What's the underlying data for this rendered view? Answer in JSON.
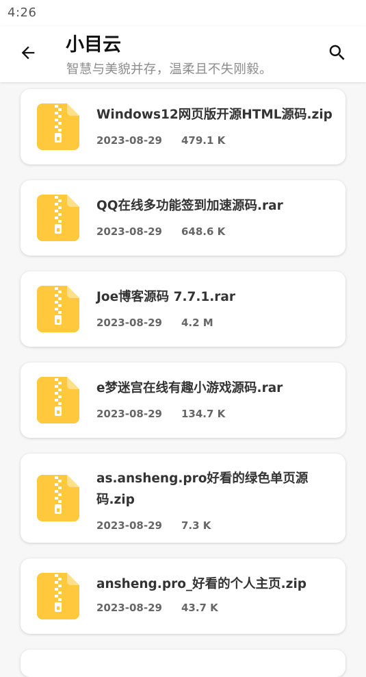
{
  "status_bar": {
    "time": "4:26"
  },
  "app_bar": {
    "title": "小目云",
    "subtitle": "智慧与美貌并存，温柔且不失刚毅。",
    "back_icon": "arrow-back-icon",
    "search_icon": "search-icon"
  },
  "colors": {
    "zip_icon": "#ffc83d",
    "zip_icon_fold": "#ffe08a",
    "text_primary": "#333333",
    "text_secondary": "#666666"
  },
  "files": [
    {
      "name": "Windows12网页版开源HTML源码.zip",
      "date": "2023-08-29",
      "size": "479.1 K",
      "icon": "zip-file-icon"
    },
    {
      "name": "QQ在线多功能签到加速源码.rar",
      "date": "2023-08-29",
      "size": "648.6 K",
      "icon": "zip-file-icon"
    },
    {
      "name": "Joe博客源码 7.7.1.rar",
      "date": "2023-08-29",
      "size": "4.2 M",
      "icon": "zip-file-icon"
    },
    {
      "name": "e梦迷宫在线有趣小游戏源码.rar",
      "date": "2023-08-29",
      "size": "134.7 K",
      "icon": "zip-file-icon"
    },
    {
      "name": "as.ansheng.pro好看的绿色单页源码.zip",
      "date": "2023-08-29",
      "size": "7.3 K",
      "icon": "zip-file-icon"
    },
    {
      "name": "ansheng.pro_好看的个人主页.zip",
      "date": "2023-08-29",
      "size": "43.7 K",
      "icon": "zip-file-icon"
    }
  ]
}
